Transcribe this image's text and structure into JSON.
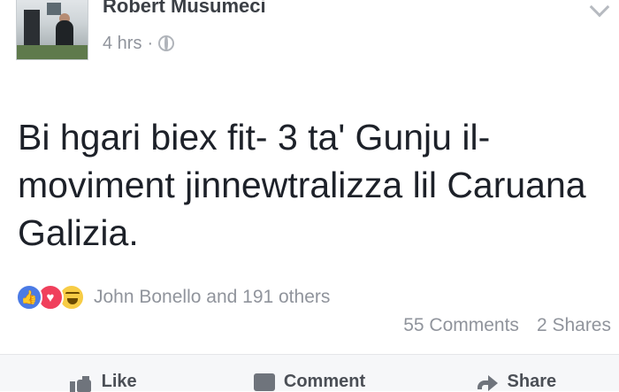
{
  "post": {
    "author": "Robert Musumeci",
    "timestamp": "4 hrs",
    "separator": "·",
    "privacy_icon": "globe-icon",
    "menu_icon": "chevron-down-icon",
    "text": "Bi hgari biex fit- 3 ta' Gunju il-moviment jinnewtralizza lil Caruana Galizia."
  },
  "reactions": {
    "icons": [
      "like-reaction-icon",
      "love-reaction-icon",
      "haha-reaction-icon"
    ],
    "names": "John Bonello and 191 others"
  },
  "counts": {
    "comments": "55 Comments",
    "shares": "2 Shares"
  },
  "actions": {
    "like": "Like",
    "comment": "Comment",
    "share": "Share"
  },
  "colors": {
    "like_blue": "#4b7be5",
    "love_red": "#f0405c",
    "haha_yellow": "#f7cc45",
    "meta_gray": "#90949c",
    "text_dark": "#1d2129"
  }
}
